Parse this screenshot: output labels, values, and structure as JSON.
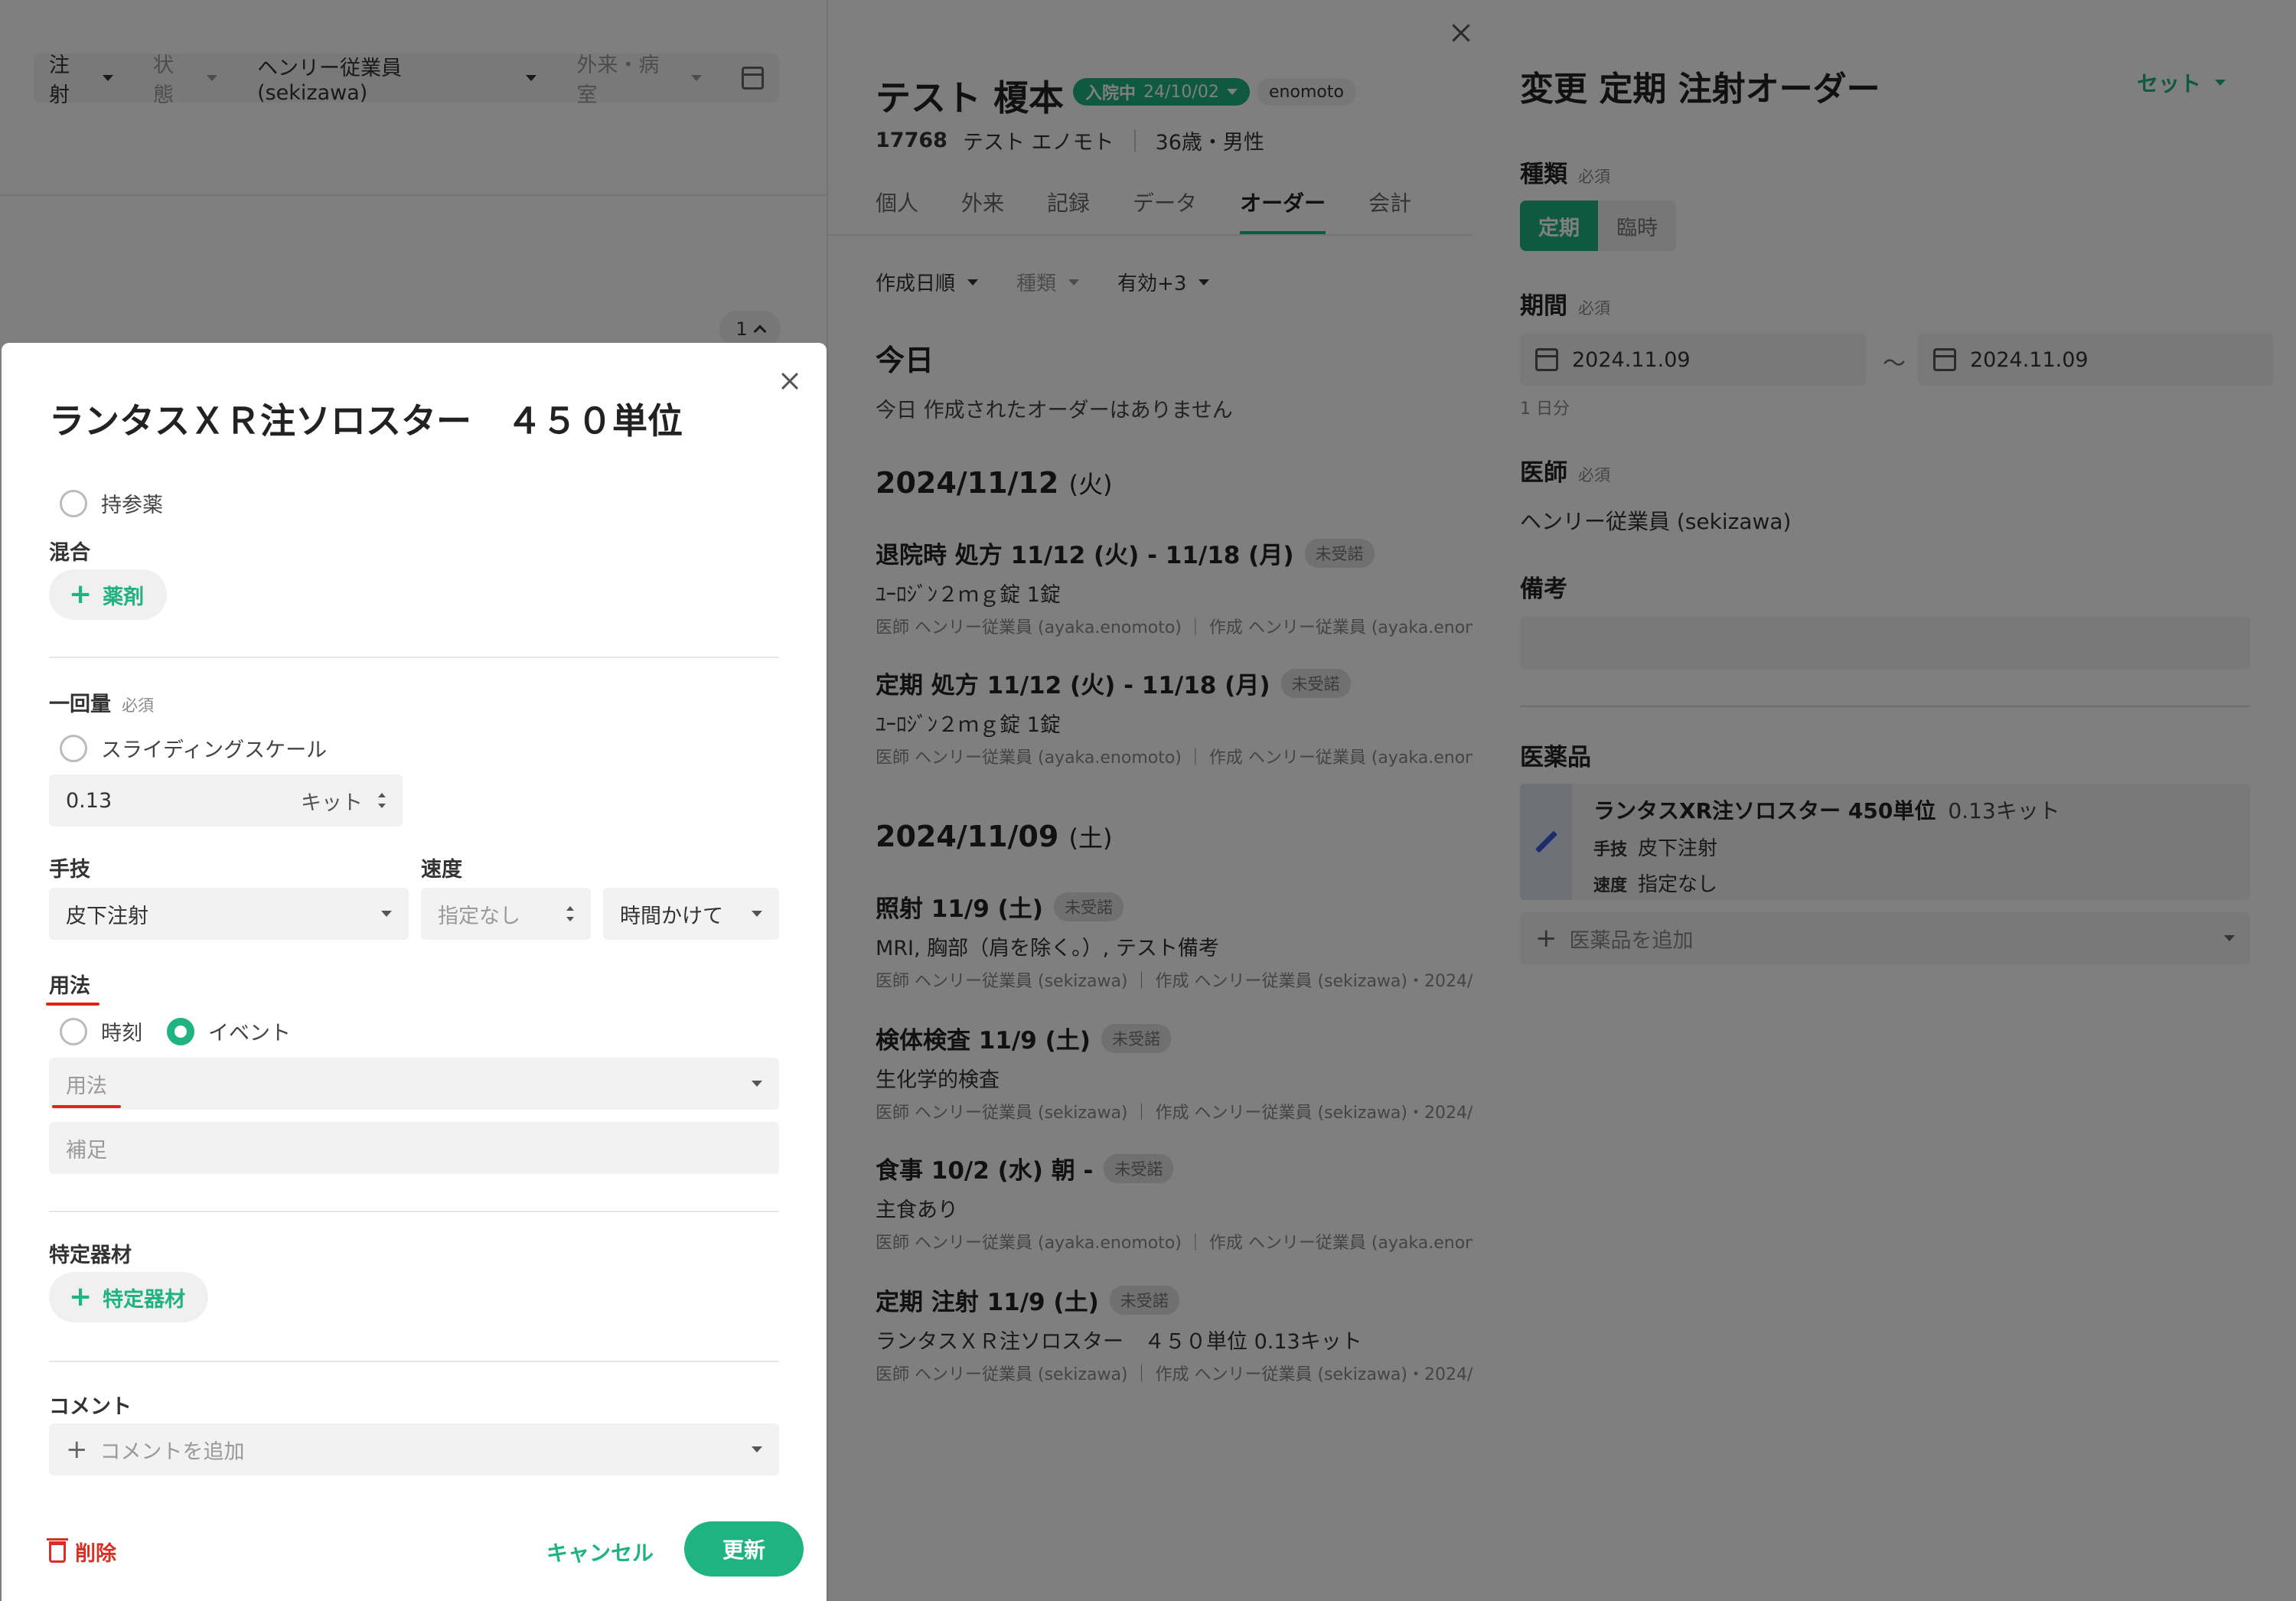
{
  "left": {
    "filters": [
      {
        "label": "注射",
        "muted": false
      },
      {
        "label": "状態",
        "muted": true
      },
      {
        "label": "ヘンリー従業員 (sekizawa)",
        "muted": false
      },
      {
        "label": "外来・病室",
        "muted": true
      }
    ],
    "page_badge": "1"
  },
  "patient": {
    "name": "テスト 榎本",
    "status": "入院中",
    "status_date": "24/10/02",
    "user_tag": "enomoto",
    "id": "17768",
    "kana": "テスト エノモト",
    "age_sex": "36歳・男性"
  },
  "tabs": [
    "個人",
    "外来",
    "記録",
    "データ",
    "オーダー",
    "会計"
  ],
  "active_tab": "オーダー",
  "sort": {
    "created": "作成日順",
    "kind": "種類",
    "valid": "有効+3"
  },
  "today": {
    "heading": "今日",
    "empty": "今日 作成されたオーダーはありません"
  },
  "groups": [
    {
      "date": "2024/11/12",
      "dow": "(火)",
      "orders": [
        {
          "title": "退院時 処方 11/12 (火) - 11/18 (月)",
          "badge": "未受諾",
          "line2": "ﾕｰﾛｼﾞﾝ２ｍｇ錠 1錠",
          "meta": "医師 ヘンリー従業員 (ayaka.enomoto) ｜ 作成 ヘンリー従業員 (ayaka.enom"
        },
        {
          "title": "定期 処方 11/12 (火) - 11/18 (月)",
          "badge": "未受諾",
          "line2": "ﾕｰﾛｼﾞﾝ２ｍｇ錠 1錠",
          "meta": "医師 ヘンリー従業員 (ayaka.enomoto) ｜ 作成 ヘンリー従業員 (ayaka.enom"
        }
      ]
    },
    {
      "date": "2024/11/09",
      "dow": "(土)",
      "orders": [
        {
          "title": "照射 11/9 (土)",
          "badge": "未受諾",
          "line2": "MRI, 胸部（肩を除く。）, テスト備考",
          "meta": "医師 ヘンリー従業員 (sekizawa) ｜ 作成 ヘンリー従業員 (sekizawa)・2024/"
        },
        {
          "title": "検体検査 11/9 (土)",
          "badge": "未受諾",
          "line2": "生化学的検査",
          "meta": "医師 ヘンリー従業員 (sekizawa) ｜ 作成 ヘンリー従業員 (sekizawa)・2024/"
        },
        {
          "title": "食事 10/2 (水) 朝 -",
          "badge": "未受諾",
          "line2": "主食あり",
          "meta": "医師 ヘンリー従業員 (ayaka.enomoto) ｜ 作成 ヘンリー従業員 (ayaka.enom"
        },
        {
          "title": "定期 注射 11/9 (土)",
          "badge": "未受諾",
          "line2": "ランタスＸＲ注ソロスター　４５０単位 0.13キット",
          "meta": "医師 ヘンリー従業員 (sekizawa) ｜ 作成 ヘンリー従業員 (sekizawa)・2024/"
        }
      ]
    }
  ],
  "right": {
    "title": "変更 定期 注射オーダー",
    "set_label": "セット",
    "required": "必須",
    "type_label": "種類",
    "type_options": [
      "定期",
      "臨時"
    ],
    "period_label": "期間",
    "date_from": "2024.11.09",
    "date_to": "2024.11.09",
    "tilde": "〜",
    "duration": "1 日分",
    "doctor_label": "医師",
    "doctor": "ヘンリー従業員 (sekizawa)",
    "notes_label": "備考",
    "meds_label": "医薬品",
    "med": {
      "name": "ランタスXR注ソロスター 450単位",
      "qty": "0.13キット",
      "technique_key": "手技",
      "technique": "皮下注射",
      "speed_key": "速度",
      "speed": "指定なし"
    },
    "add_med_placeholder": "医薬品を追加"
  },
  "modal": {
    "title": "ランタスＸＲ注ソロスター　４５０単位",
    "own_drug": "持参薬",
    "mix_label": "混合",
    "add_drug": "薬剤",
    "dose_label": "一回量",
    "required": "必須",
    "sliding_scale": "スライディングスケール",
    "dose_value": "0.13",
    "dose_unit": "キット",
    "technique_label": "手技",
    "technique_value": "皮下注射",
    "speed_label": "速度",
    "speed_placeholder": "指定なし",
    "speed_mode": "時間かけて",
    "usage_label": "用法",
    "usage_time": "時刻",
    "usage_event": "イベント",
    "usage_placeholder": "用法",
    "supplement_placeholder": "補足",
    "special_material_label": "特定器材",
    "add_special_material": "特定器材",
    "comment_label": "コメント",
    "comment_placeholder": "コメントを追加",
    "delete": "削除",
    "cancel": "キャンセル",
    "update": "更新"
  },
  "colors": {
    "accent": "#1fb381",
    "danger": "#d93025",
    "underline": "#e0241b"
  }
}
